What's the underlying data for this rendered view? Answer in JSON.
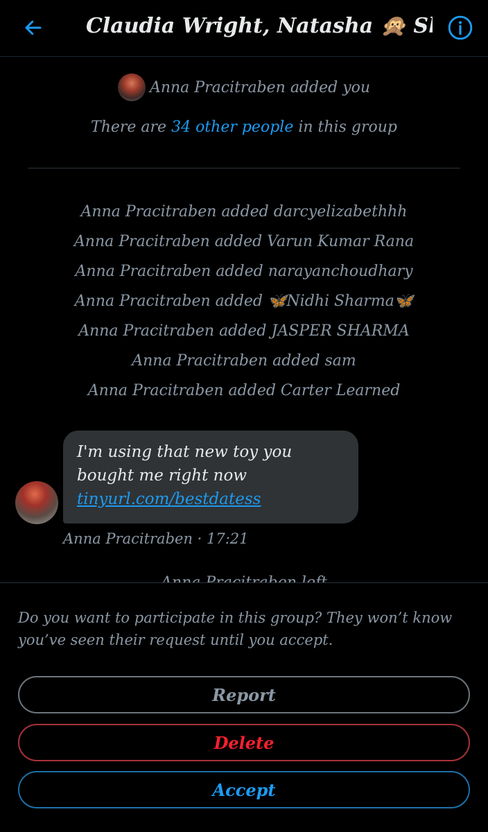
{
  "header": {
    "title": "Claudia Wright, Natasha 🙊 Shea,...",
    "back_icon": "arrow-left-icon",
    "info_icon": "info-circle-icon"
  },
  "system": {
    "added_you": "Anna Pracitraben added you",
    "group_count_prefix": "There are ",
    "group_count_link": "34 other people",
    "group_count_suffix": " in this group"
  },
  "events": [
    "Anna Pracitraben added darcyelizabethhh",
    "Anna Pracitraben added Varun Kumar Rana",
    "Anna Pracitraben added narayanchoudhary",
    "Anna Pracitraben added 🦋Nidhi Sharma🦋",
    "Anna Pracitraben added JASPER SHARMA",
    "Anna Pracitraben added sam",
    "Anna Pracitraben added Carter Learned"
  ],
  "message": {
    "text": "I'm using that new toy you bought me right now",
    "link": "tinyurl.com/bestdatess",
    "meta": "Anna Pracitraben · 17:21"
  },
  "clipped_event": "Anna Pracitraben left",
  "request": {
    "prompt": "Do you want to participate in this group? They won’t know you’ve seen their request until you accept.",
    "report_label": "Report",
    "delete_label": "Delete",
    "accept_label": "Accept"
  },
  "colors": {
    "accent": "#1d9bf0",
    "danger": "#f4212e",
    "muted_text": "#8b98a5",
    "bubble": "#2f3336"
  }
}
